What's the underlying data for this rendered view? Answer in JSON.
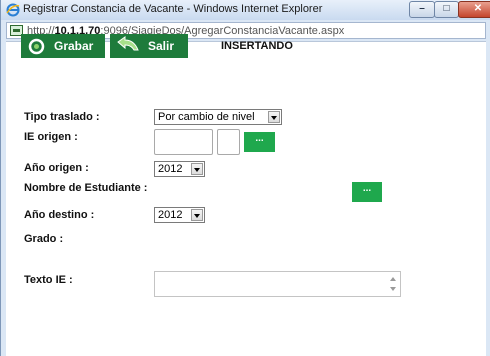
{
  "window": {
    "title": "Registrar Constancia de Vacante - Windows Internet Explorer",
    "url_prefix": "http://",
    "url_host": "10.1.1.70",
    "url_rest": ":9096/SiagieDos/AgregarConstanciaVacante.aspx",
    "min_glyph": "–",
    "max_glyph": "□",
    "close_glyph": "✕"
  },
  "toolbar": {
    "grabar_label": "Grabar",
    "salir_label": "Salir",
    "status": "INSERTANDO"
  },
  "form": {
    "tipo_traslado_label": "Tipo traslado :",
    "tipo_traslado_value": "Por cambio de nivel",
    "ie_origen_label": "IE origen :",
    "lookup_label": "...",
    "anio_origen_label": "Año origen :",
    "anio_origen_value": "2012",
    "nombre_estudiante_label": "Nombre de Estudiante :",
    "anio_destino_label": "Año destino :",
    "anio_destino_value": "2012",
    "grado_label": "Grado :",
    "texto_ie_label": "Texto IE :"
  },
  "colors": {
    "toolbar_green": "#1e7b3b",
    "lookup_green": "#1fa84d"
  },
  "icons": [
    "ie-icon",
    "page-icon",
    "save-icon",
    "exit-arrow-icon"
  ]
}
